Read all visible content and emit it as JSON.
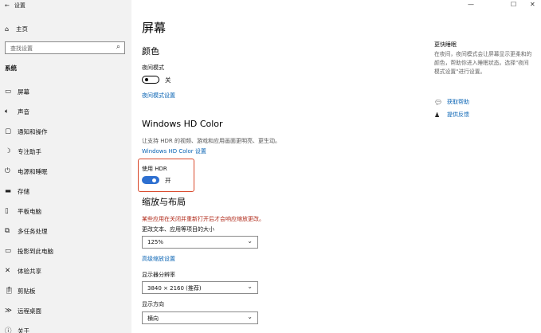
{
  "window": {
    "title": "设置",
    "controls": {
      "minimize": "—",
      "maximize": "☐",
      "close": "✕"
    }
  },
  "sidebar": {
    "home_label": "主页",
    "search_placeholder": "查找设置",
    "section_label": "系统",
    "items": [
      {
        "icon": "monitor-icon",
        "glyph": "▭",
        "label": "屏幕"
      },
      {
        "icon": "speaker-icon",
        "glyph": "🔈︎",
        "label": "声音"
      },
      {
        "icon": "notification-icon",
        "glyph": "▢",
        "label": "通知和操作"
      },
      {
        "icon": "moon-icon",
        "glyph": "☽",
        "label": "专注助手"
      },
      {
        "icon": "power-icon",
        "glyph": "⏻",
        "label": "电源和睡眠"
      },
      {
        "icon": "storage-icon",
        "glyph": "▬",
        "label": "存储"
      },
      {
        "icon": "tablet-icon",
        "glyph": "▯",
        "label": "平板电脑"
      },
      {
        "icon": "multitask-icon",
        "glyph": "⧉",
        "label": "多任务处理"
      },
      {
        "icon": "project-icon",
        "glyph": "▭",
        "label": "投影到此电脑"
      },
      {
        "icon": "share-icon",
        "glyph": "✕",
        "label": "体验共享"
      },
      {
        "icon": "clipboard-icon",
        "glyph": "📋︎",
        "label": "剪贴板"
      },
      {
        "icon": "remote-icon",
        "glyph": "≫",
        "label": "远程桌面"
      },
      {
        "icon": "info-icon",
        "glyph": "ⓘ",
        "label": "关于"
      }
    ]
  },
  "main": {
    "page_title": "屏幕",
    "color_section": {
      "title": "颜色",
      "night_label": "夜间模式",
      "night_state": "关",
      "night_link": "夜间模式设置"
    },
    "hdr_section": {
      "title": "Windows HD Color",
      "desc": "让支持 HDR 的视频、游戏和应用画面更明亮、更生动。",
      "link": "Windows HD Color 设置",
      "use_hdr_label": "使用 HDR",
      "use_hdr_state": "开"
    },
    "scale_section": {
      "title": "缩放与布局",
      "warning": "某些应用在关闭并重新打开后才会响应缩放更改。",
      "size_label": "更改文本、应用等项目的大小",
      "size_value": "125%",
      "advanced_link": "高级缩放设置",
      "resolution_label": "显示器分辨率",
      "resolution_value": "3840 × 2160 (推荐)",
      "orientation_label": "显示方向",
      "orientation_value": "横向"
    }
  },
  "right_panel": {
    "related_title": "更快睡眠",
    "related_text": "在夜间，夜间模式会让屏幕显示更柔和的颜色，帮助你进入睡眠状态。选择\"夜间模式设置\"进行设置。",
    "help_label": "获取帮助",
    "feedback_label": "提供反馈"
  },
  "colors": {
    "accent": "#2d6fd0",
    "link": "#0a64b4",
    "warning": "#b02a1a",
    "highlight_box": "#d9482a"
  }
}
